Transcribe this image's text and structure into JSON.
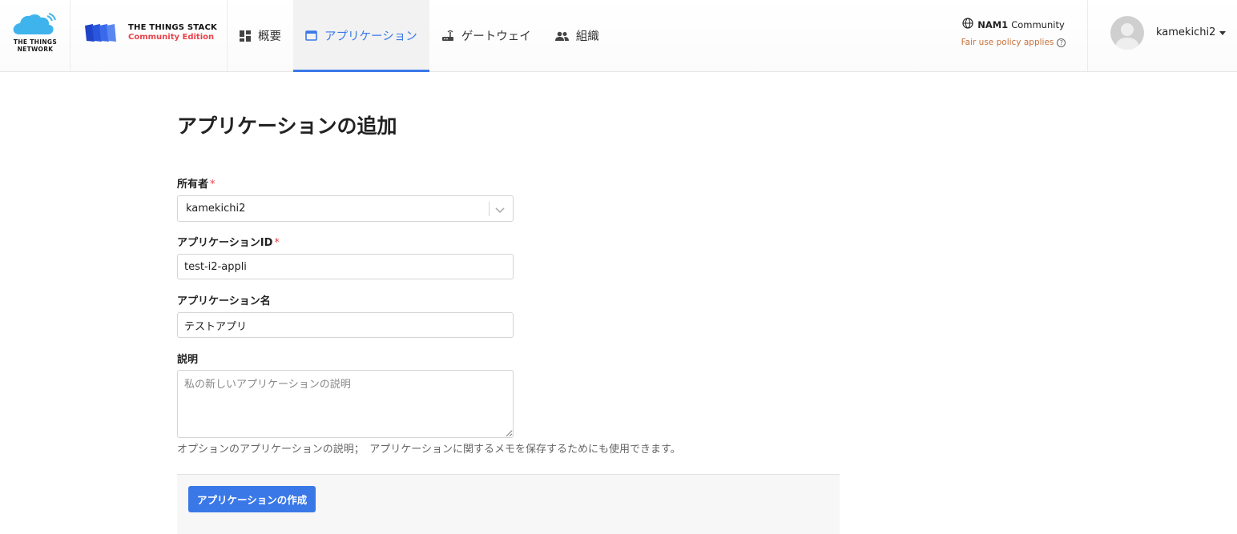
{
  "brand": {
    "ttn_line1": "THE THINGS",
    "ttn_line2": "NETWORK",
    "tts_line1": "THE THINGS STACK",
    "tts_line2": "Community Edition",
    "accent_color": "#3a78e8",
    "edition_color": "#e8424a"
  },
  "nav": {
    "items": [
      {
        "label": "概要",
        "icon": "dashboard-icon",
        "active": false
      },
      {
        "label": "アプリケーション",
        "icon": "application-icon",
        "active": true
      },
      {
        "label": "ゲートウェイ",
        "icon": "gateway-icon",
        "active": false
      },
      {
        "label": "組織",
        "icon": "people-icon",
        "active": false
      }
    ]
  },
  "cluster": {
    "name": "NAM1",
    "suffix": "Community",
    "policy": "Fair use policy applies"
  },
  "user": {
    "username": "kamekichi2"
  },
  "form": {
    "title": "アプリケーションの追加",
    "owner_label": "所有者",
    "owner_value": "kamekichi2",
    "app_id_label": "アプリケーションID",
    "app_id_value": "test-i2-appli",
    "app_name_label": "アプリケーション名",
    "app_name_value": "テストアプリ",
    "description_label": "説明",
    "description_value": "",
    "description_placeholder": "私の新しいアプリケーションの説明",
    "description_hint": "オプションのアプリケーションの説明；　アプリケーションに関するメモを保存するためにも使用できます。",
    "required_mark": "*",
    "submit_label": "アプリケーションの作成"
  }
}
